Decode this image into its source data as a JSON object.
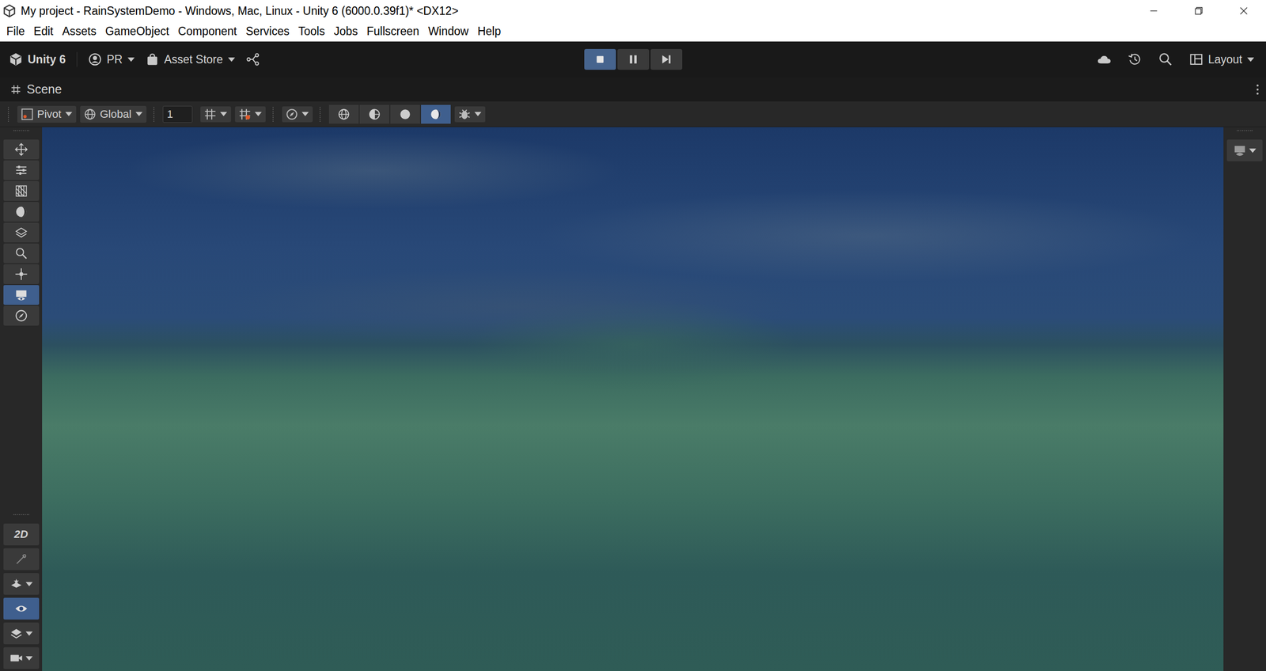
{
  "window": {
    "title": "My project - RainSystemDemo - Windows, Mac, Linux - Unity 6 (6000.0.39f1)* <DX12>"
  },
  "menu": [
    "File",
    "Edit",
    "Assets",
    "GameObject",
    "Component",
    "Services",
    "Tools",
    "Jobs",
    "Fullscreen",
    "Window",
    "Help"
  ],
  "toolbar": {
    "brand": "Unity 6",
    "account": "PR",
    "store": "Asset Store",
    "layout": "Layout"
  },
  "play_controls": [
    {
      "kind": "play",
      "selected": true
    },
    {
      "kind": "pause",
      "selected": false
    },
    {
      "kind": "step",
      "selected": false
    }
  ],
  "scene_tab": {
    "label": "Scene"
  },
  "scene_toolbar": {
    "pivot": "Pivot",
    "space": "Global",
    "grid_size": "1",
    "shading_modes": [
      {
        "kind": "wireframe",
        "selected": false
      },
      {
        "kind": "shaded-wireframe",
        "selected": false
      },
      {
        "kind": "shaded",
        "selected": false
      },
      {
        "kind": "lit",
        "selected": true
      }
    ]
  },
  "tools": [
    {
      "kind": "move",
      "selected": false
    },
    {
      "kind": "adjust",
      "selected": false
    },
    {
      "kind": "grid",
      "selected": false
    },
    {
      "kind": "circle",
      "selected": false
    },
    {
      "kind": "layers",
      "selected": false
    },
    {
      "kind": "zoom",
      "selected": false
    },
    {
      "kind": "transform",
      "selected": false
    },
    {
      "kind": "camera",
      "selected": true
    },
    {
      "kind": "compass",
      "selected": false
    }
  ],
  "overlays": [
    {
      "kind": "toggle2d",
      "label": "2D",
      "selected": false,
      "dropdown": false
    },
    {
      "kind": "light",
      "label": "",
      "selected": false,
      "dropdown": false
    },
    {
      "kind": "effects",
      "label": "",
      "selected": false,
      "dropdown": true
    },
    {
      "kind": "visibility",
      "label": "",
      "selected": true,
      "dropdown": false
    },
    {
      "kind": "layers",
      "label": "",
      "selected": false,
      "dropdown": true
    },
    {
      "kind": "camera",
      "label": "",
      "selected": false,
      "dropdown": true
    }
  ]
}
